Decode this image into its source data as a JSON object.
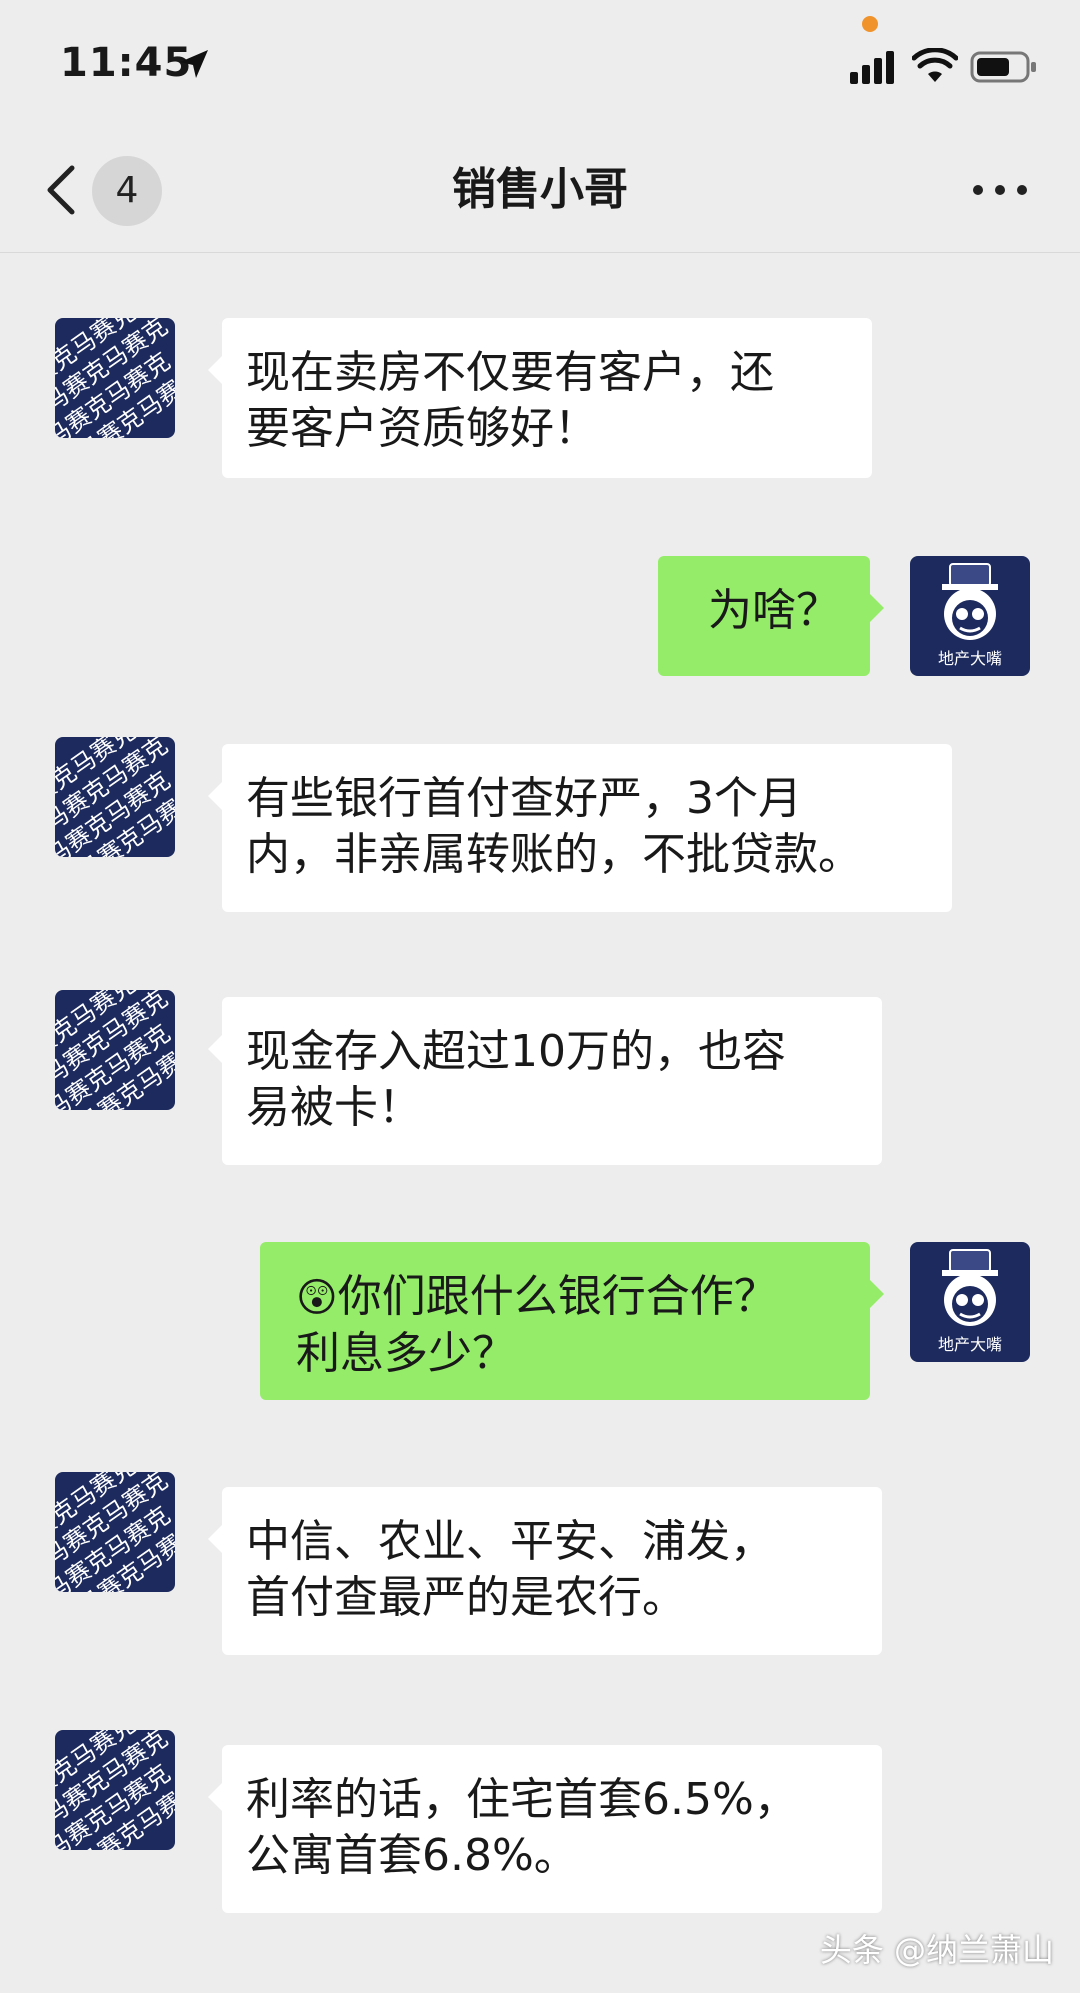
{
  "status_bar": {
    "time": "11:45"
  },
  "nav": {
    "unread_count": "4",
    "title": "销售小哥"
  },
  "avatars": {
    "contact_text": "马赛克",
    "me_caption": "地产大嘴"
  },
  "messages": [
    {
      "side": "in",
      "text": "现在卖房不仅要有客户，还\n要客户资质够好！"
    },
    {
      "side": "out",
      "text": "为啥？"
    },
    {
      "side": "in",
      "text": "有些银行首付查好严，3个月\n内，非亲属转账的，不批贷款。"
    },
    {
      "side": "in",
      "text": "现金存入超过10万的，也容\n易被卡！"
    },
    {
      "side": "out",
      "text": "你们跟什么银行合作？\n利息多少？",
      "emoji": "😲"
    },
    {
      "side": "in",
      "text": "中信、农业、平安、浦发，\n首付查最严的是农行。"
    },
    {
      "side": "in",
      "text": "利率的话，住宅首套6.5%，\n公寓首套6.8%。"
    }
  ],
  "watermark": "头条 @纳兰萧山",
  "colors": {
    "background": "#ededed",
    "incoming_bubble": "#ffffff",
    "outgoing_bubble": "#95ec69",
    "avatar_blue": "#1c2a5e"
  }
}
